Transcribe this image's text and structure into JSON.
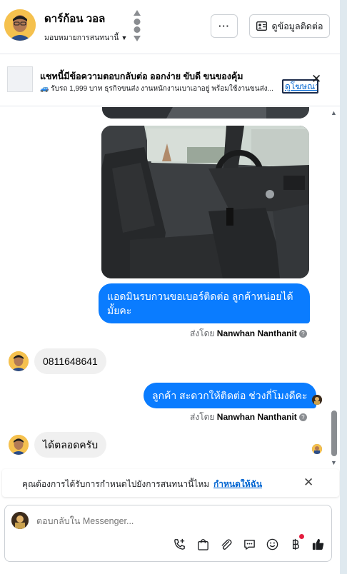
{
  "header": {
    "contact_name": "ดาร์ก้อน วอล",
    "assign_label": "มอบหมายการสนทนานี้",
    "more_label": "···",
    "contact_info_label": "ดูข้อมูลติดต่อ"
  },
  "ad": {
    "title": "แชทนี้มีข้อความตอบกลับต่อ ออกง่าย ขับดี ขนของคุ้ม",
    "subtitle": "🚙 รับรถ 1,999 บาท ธุรกิจขนส่ง งานหนักงานเบาเอาอยู่ พร้อมใช้งานขนส่ง...",
    "link_label": "ดูโฆษณา"
  },
  "messages": [
    {
      "type": "image_partial",
      "direction": "out"
    },
    {
      "type": "image",
      "direction": "out",
      "alt": "car-interior-photo"
    },
    {
      "type": "text",
      "direction": "out",
      "text": "แอดมินรบกวนขอเบอร์ติดต่อ ลูกค้าหน่อยได้มั้ยคะ"
    },
    {
      "type": "text",
      "direction": "in",
      "text": "0811648641"
    },
    {
      "type": "text",
      "direction": "out",
      "text": "ลูกค้า สะดวกให้ติดต่อ ช่วงกี่โมงดีคะ"
    },
    {
      "type": "text",
      "direction": "in",
      "text": "ได้ตลอดครับ"
    }
  ],
  "sent_by": {
    "prefix": "ส่งโดย",
    "name": "Nanwhan Nanthanit",
    "help": "?"
  },
  "reminder": {
    "text": "คุณต้องการได้รับการกำหนดไปยังการสนทนานี้ไหม",
    "link": "กำหนดให้ฉัน"
  },
  "composer": {
    "placeholder": "ตอบกลับใน Messenger...",
    "tools": [
      "phone-add-icon",
      "shopping-bag-icon",
      "attachment-icon",
      "saved-reply-icon",
      "emoji-icon",
      "baht-payment-icon",
      "thumbs-up-icon"
    ]
  },
  "colors": {
    "outgoing_bubble": "#0a7cff",
    "incoming_bubble": "#f0f0f0",
    "link": "#0064d1",
    "notification_dot": "#e41e3f"
  }
}
